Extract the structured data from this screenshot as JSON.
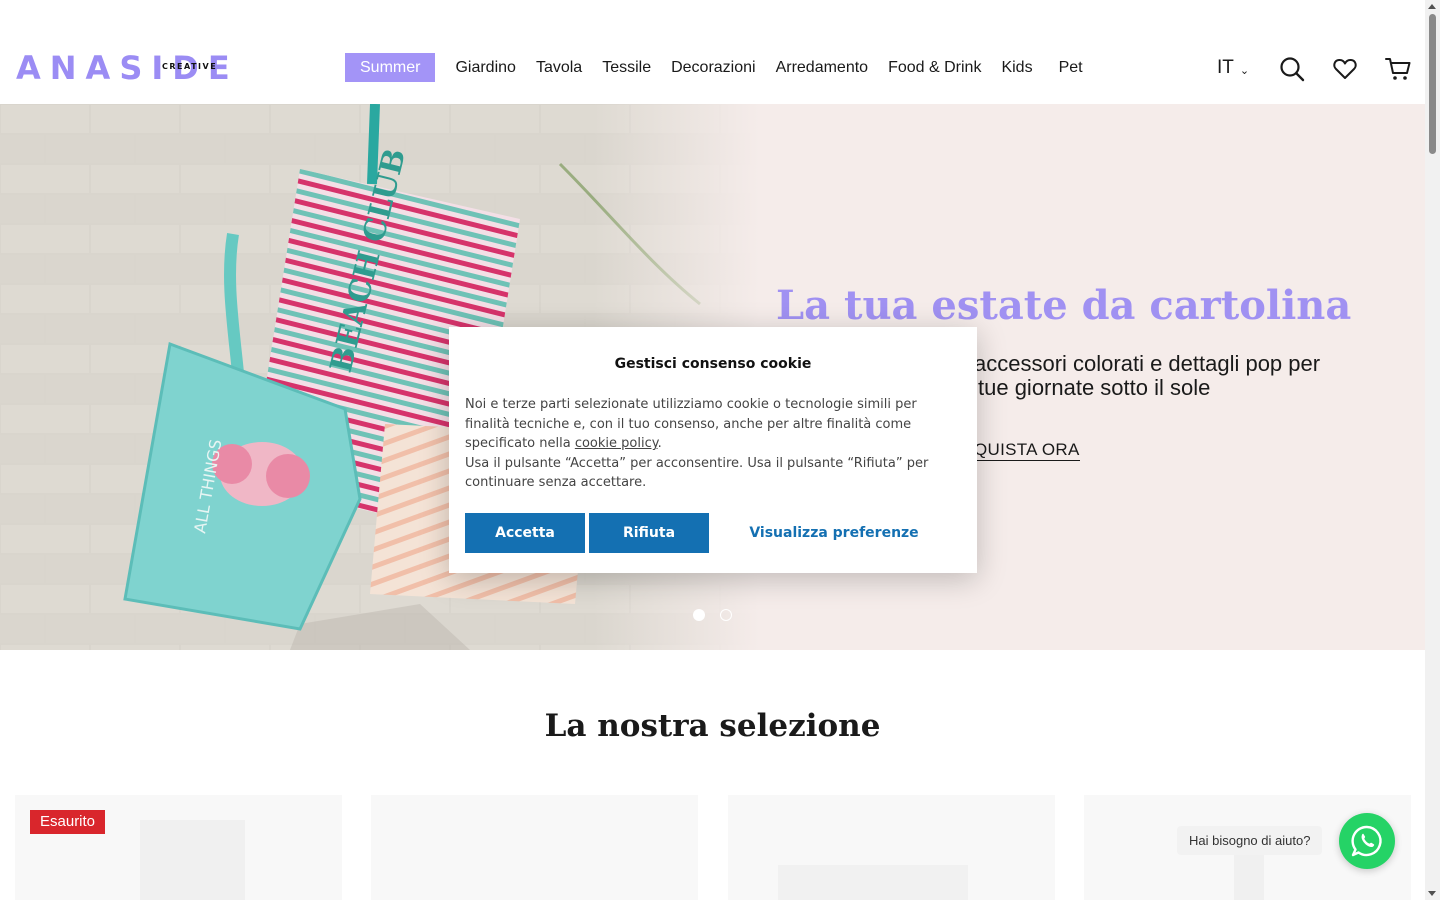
{
  "brand": {
    "name": "ANASIDE",
    "tagline": "CREATIVE"
  },
  "nav": {
    "items": [
      "Summer",
      "Giardino",
      "Tavola",
      "Tessile",
      "Decorazioni",
      "Arredamento",
      "Food & Drink",
      "Kids",
      "Pet"
    ],
    "active": "Summer"
  },
  "header": {
    "language": "IT",
    "icons": [
      "search-icon",
      "heart-icon",
      "cart-icon"
    ]
  },
  "hero": {
    "title": "La tua estate da cartolina",
    "subtitle_visible": "accessori colorati e dettagli pop per tue giornate sotto il sole",
    "subtitle_line1": "accessori colorati e dettagli pop per",
    "subtitle_line2": "tue giornate sotto il sole",
    "cta_visible": "QUISTA ORA",
    "slides": 2,
    "active_slide": 1
  },
  "cookie_modal": {
    "title": "Gestisci consenso cookie",
    "text_part1": "Noi e terze parti selezionate utilizziamo cookie o tecnologie simili per finalità tecniche e, con il tuo consenso, anche per altre finalità come specificato nella ",
    "link": "cookie policy",
    "text_part2": ".",
    "text_line2": "Usa il pulsante “Accetta” per acconsentire. Usa il pulsante “Rifiuta” per continuare senza accettare.",
    "accept": "Accetta",
    "reject": "Rifiuta",
    "preferences": "Visualizza preferenze"
  },
  "section": {
    "title": "La nostra selezione"
  },
  "products": [
    {
      "badge": "Esaurito"
    },
    {
      "badge": ""
    },
    {
      "badge": ""
    },
    {
      "badge": ""
    }
  ],
  "chat": {
    "bubble": "Hai bisogno di aiuto?"
  },
  "colors": {
    "brand": "#9b8cf4",
    "nav_active_bg": "#a394f7",
    "hero_bg": "#f5ecea",
    "badge": "#d9262c",
    "cookie_button": "#1470b2",
    "whatsapp": "#25d366"
  }
}
